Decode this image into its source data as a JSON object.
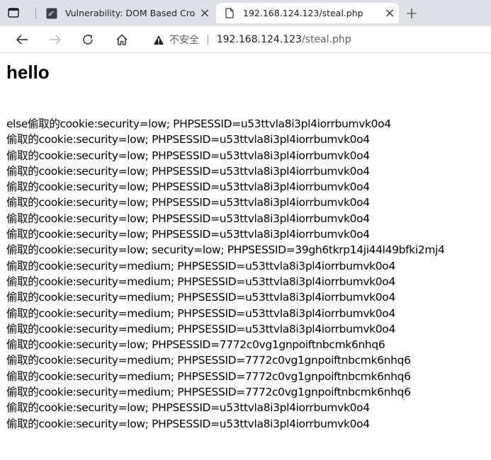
{
  "browser": {
    "tabs": [
      {
        "title": "Vulnerability: DOM Based Cross Site Scripting",
        "active": false
      },
      {
        "title": "192.168.124.123/steal.php",
        "active": true
      }
    ],
    "new_tab_label": "+",
    "close_glyph": "×",
    "address": {
      "security_label": "不安全",
      "separator": "|",
      "host": "192.168.124.123",
      "path": "/steal.php"
    },
    "icons": [
      "tab-actions-icon",
      "dvwa-favicon-icon",
      "page-icon",
      "close-icon",
      "new-tab-icon",
      "back-icon",
      "forward-icon",
      "reload-icon",
      "home-icon",
      "warning-icon"
    ]
  },
  "page": {
    "heading": "hello",
    "lines": [
      "else偷取的cookie:security=low; PHPSESSID=u53ttvla8i3pl4iorrbumvk0o4",
      "偷取的cookie:security=low; PHPSESSID=u53ttvla8i3pl4iorrbumvk0o4",
      "偷取的cookie:security=low; PHPSESSID=u53ttvla8i3pl4iorrbumvk0o4",
      "偷取的cookie:security=low; PHPSESSID=u53ttvla8i3pl4iorrbumvk0o4",
      "偷取的cookie:security=low; PHPSESSID=u53ttvla8i3pl4iorrbumvk0o4",
      "偷取的cookie:security=low; PHPSESSID=u53ttvla8i3pl4iorrbumvk0o4",
      "偷取的cookie:security=low; PHPSESSID=u53ttvla8i3pl4iorrbumvk0o4",
      "偷取的cookie:security=low; PHPSESSID=u53ttvla8i3pl4iorrbumvk0o4",
      "偷取的cookie:security=low; security=low; PHPSESSID=39gh6tkrp14ji44l49bfki2mj4",
      "偷取的cookie:security=medium; PHPSESSID=u53ttvla8i3pl4iorrbumvk0o4",
      "偷取的cookie:security=medium; PHPSESSID=u53ttvla8i3pl4iorrbumvk0o4",
      "偷取的cookie:security=medium; PHPSESSID=u53ttvla8i3pl4iorrbumvk0o4",
      "偷取的cookie:security=medium; PHPSESSID=u53ttvla8i3pl4iorrbumvk0o4",
      "偷取的cookie:security=medium; PHPSESSID=u53ttvla8i3pl4iorrbumvk0o4",
      "偷取的cookie:security=low; PHPSESSID=7772c0vg1gnpoiftnbcmk6nhq6",
      "偷取的cookie:security=medium; PHPSESSID=7772c0vg1gnpoiftnbcmk6nhq6",
      "偷取的cookie:security=medium; PHPSESSID=7772c0vg1gnpoiftnbcmk6nhq6",
      "偷取的cookie:security=medium; PHPSESSID=7772c0vg1gnpoiftnbcmk6nhq6",
      "偷取的cookie:security=low; PHPSESSID=u53ttvla8i3pl4iorrbumvk0o4",
      "偷取的cookie:security=low; PHPSESSID=u53ttvla8i3pl4iorrbumvk0o4"
    ]
  },
  "colors": {
    "tabbar_bg": "#dee1e6",
    "active_tab_bg": "#ffffff",
    "text": "#000000",
    "muted": "#5f6368"
  }
}
